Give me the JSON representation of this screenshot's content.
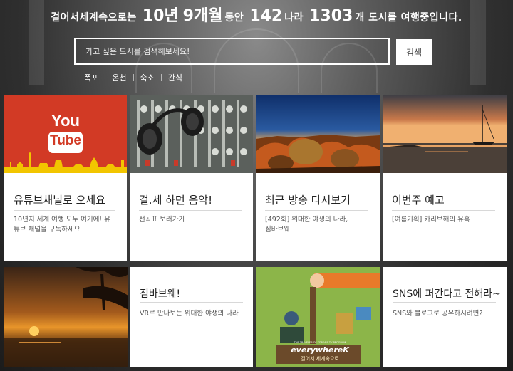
{
  "header": {
    "text_before": "걸어서세계속으로는",
    "years": "10년",
    "months": "9개월",
    "text_during": "동안",
    "countries_num": "142",
    "countries_unit": "나라",
    "cities_num": "1303",
    "text_after": "개 도시를 여행중입니다."
  },
  "search": {
    "placeholder": "가고 싶은 도시를 검색해보세요!",
    "value": "",
    "button_label": "검색"
  },
  "quick_links": [
    {
      "label": "폭포"
    },
    {
      "label": "온천"
    },
    {
      "label": "숙소"
    },
    {
      "label": "간식"
    }
  ],
  "cards": [
    {
      "title": "유튜브채널로 오세요",
      "desc": "10년치 세계 여행 모두 여기에! 유튜브 채널을 구독하세요",
      "image_text_1": "You",
      "image_text_2": "Tube"
    },
    {
      "title": "걸.세 하면 음악!",
      "desc": "선곡표 보러가기"
    },
    {
      "title": "최근 방송 다시보기",
      "desc": "[492회] 위대한 야생의 나라, 짐바브웨"
    },
    {
      "title": "이번주 예고",
      "desc": "[여름기획] 카리브해의 유혹"
    }
  ],
  "row2": [
    {
      "title": "짐바브웨!",
      "desc": "VR로 만나보는 위대한 야생의 나라"
    },
    {
      "title": "SNS에 퍼간다고 전해라~",
      "desc": "SNS와 블로그로 공유하시려면?",
      "logo_line_1": "everywhereK",
      "logo_line_2": "걸어서 세계속으로",
      "logo_tagline": "THE TRAVELER OF KOREA'S TV PROGRAM"
    }
  ],
  "colors": {
    "youtube_red": "#d23a25",
    "youtube_yellow": "#f2c500",
    "sns_green": "#8cb549",
    "sns_orange": "#e87a2a"
  }
}
